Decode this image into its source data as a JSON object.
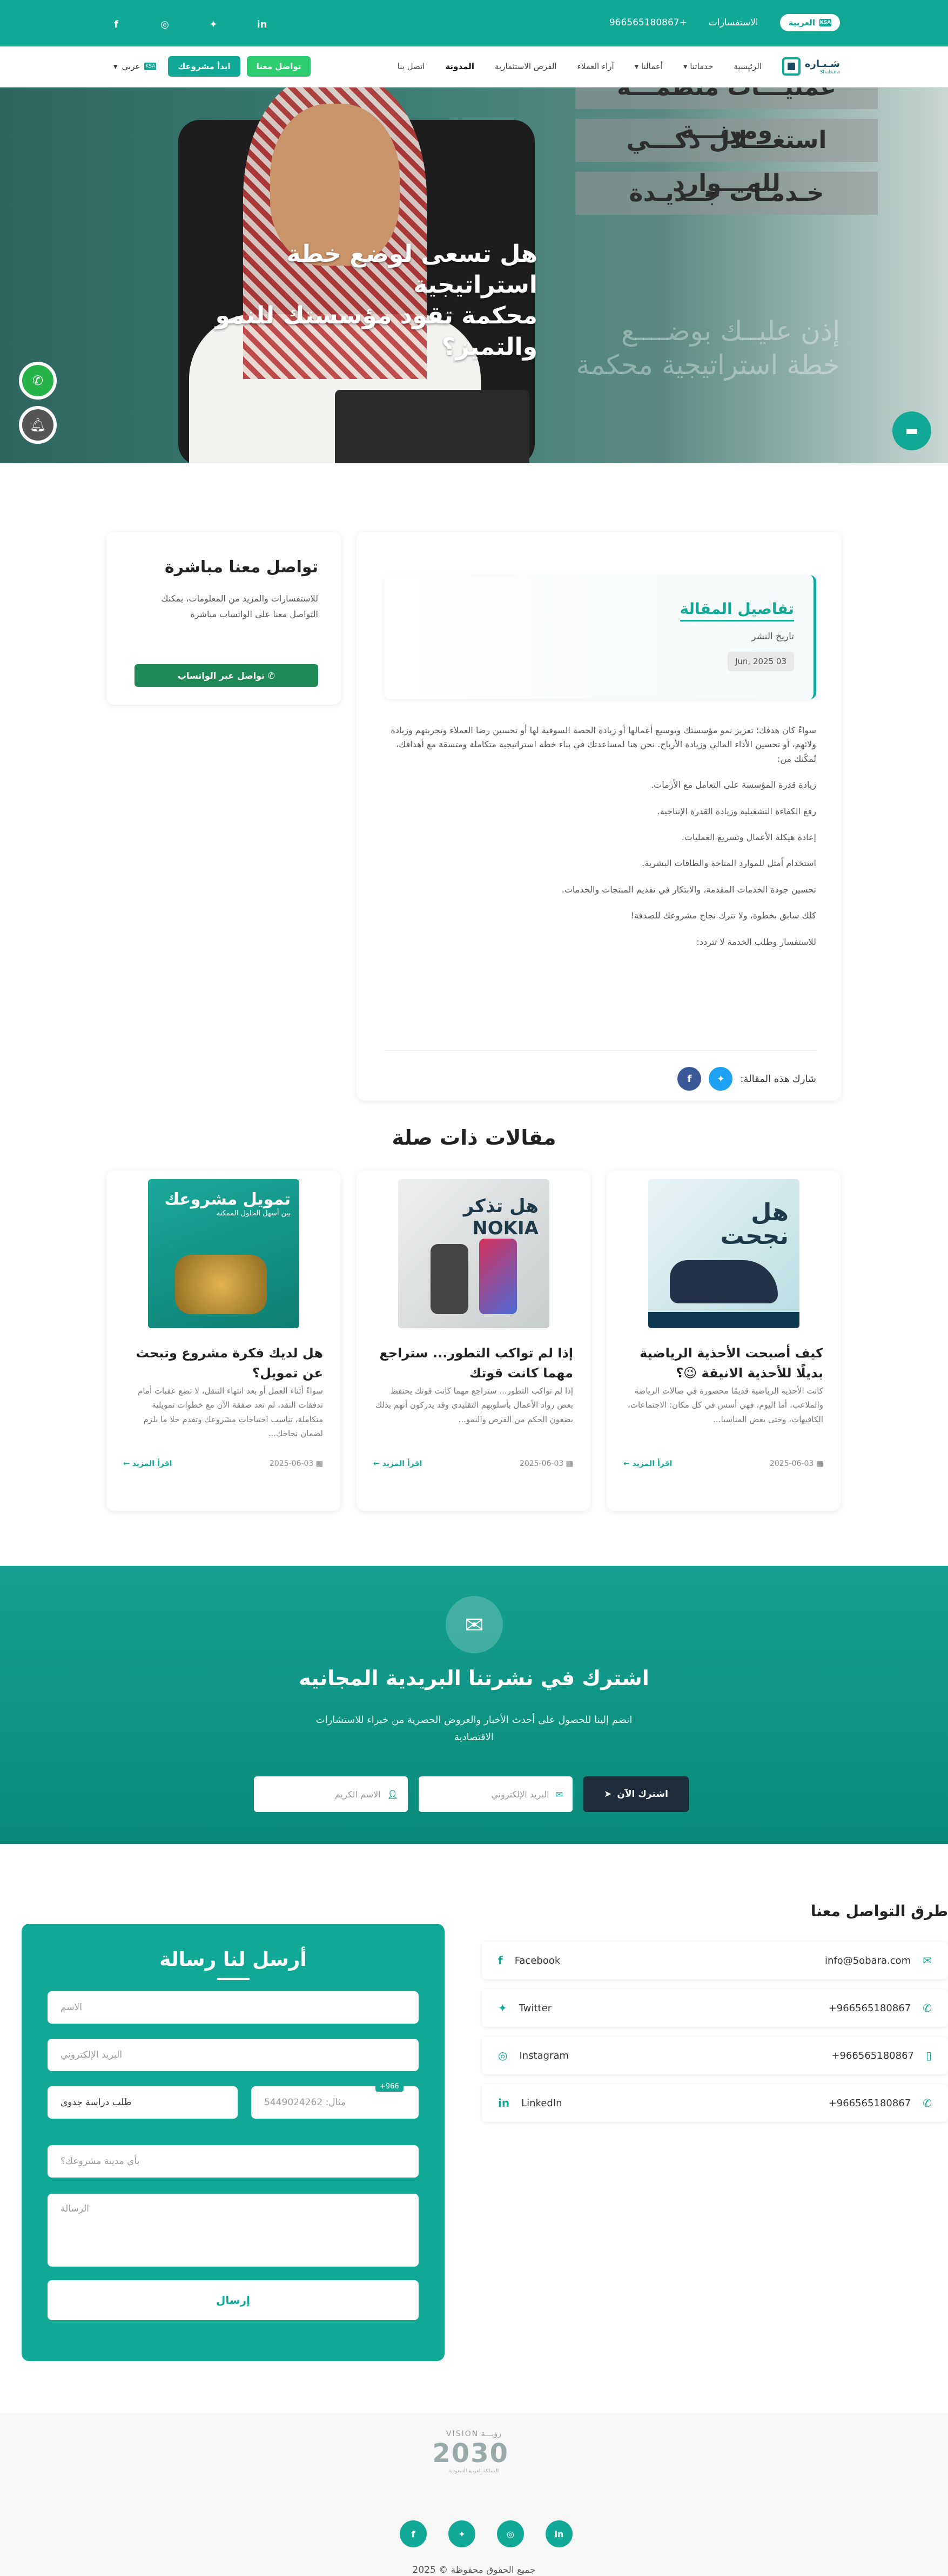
{
  "topbar": {
    "lang_label": "العربية",
    "flag": "KSA",
    "consult_label": "الاستفسارات",
    "phone": "966565180867+",
    "social_icons": [
      "in",
      "t",
      "ig",
      "f"
    ]
  },
  "nav": {
    "logo": "شـبـاره",
    "logo_sub": "Shabara",
    "links": [
      "الرئيسية",
      "خدماتنا",
      "أعمالنا",
      "آراء العملاء",
      "الفرص الاستثمارية",
      "المدونة",
      "اتصل بنا"
    ],
    "lang_select": "عربي",
    "start_project": "ابدأ مشروعك",
    "contact_us": "تواصل معنا"
  },
  "hero": {
    "bars": [
      "عمليـــات منظمـــة ومرنـــة",
      "استغـــلال ذكـــي للمـــوارد",
      "خـدمـات جــديـدة"
    ],
    "title_line1": "هل تسعى لوضع خطة استراتيجية",
    "title_line2": "محكمة تقود مؤسستك للنمو والتميز؟",
    "sub_line1": "إذن عليــك بوضــــع",
    "sub_line2": "خطة استراتيجية محكمة"
  },
  "article": {
    "details_title": "تفاصيل المقالة",
    "date_label": "تاريخ النشر",
    "date": "Jun, 2025 03",
    "intro": "سواءً كان هدفك؛ تعزيز نمو مؤسستك وتوسيع أعمالها أو زيادة الحصة السوقية لها أو تحسين رضا العملاء وتجربتهم وزيادة ولائهم، أو تحسين الأداء المالي وزيادة الأرباح. نحن هنا لمساعدتك في بناء خطة استراتيجية متكاملة ومتسقة مع أهدافك، تُمكّنك من:",
    "points": [
      "زيادة قدرة المؤسسة على التعامل مع الأزمات.",
      "رفع الكفاءة التشغيلية وزيادة القدرة الإنتاجية.",
      "إعادة هيكلة الأعمال وتسريع العمليات.",
      "استخدام أمثل للموارد المتاحة والطاقات البشرية.",
      "تحسين جودة الخدمات المقدمة، والابتكار في تقديم المنتجات والخدمات.",
      "كلك سابق بخطوة، ولا تترك نجاح مشروعك للصدفة!",
      "للاستفسار وطلب الخدمة لا تتردد:"
    ],
    "share_label": "شارك هذه المقالة:"
  },
  "contact_box": {
    "title": "تواصل معنا مباشرة",
    "text": "للاستفسارات والمزيد من المعلومات، يمكنك التواصل معنا على الواتساب مباشرة",
    "button": "تواصل عبر الواتساب"
  },
  "related": {
    "title": "مقالات ذات صلة",
    "items": [
      {
        "title": "كيف أصبحت الأحذية الرياضية بديلًا للأحذية الانيقة 😉؟",
        "excerpt": "كانت الأحذية الرياضية قديمًا محصورة في صالات الرياضة والملاعب، أما اليوم، فهي أسس في كل مكان: الاجتماعات، الكافيهات، وحتى بعض المناسبا...",
        "date": "2025-06-03",
        "more": "اقرأ المزيد",
        "img_text1": "هل",
        "img_text2": "نجحت"
      },
      {
        "title": "إذا لم تواكب التطور... ستراجع مهما كانت قوتك",
        "excerpt": "إذا لم تواكب التطور... ستراجع مهما كانت قوتك يحتفظ بعض رواد الأعمال بأسلوبهم التقليدي وقد يدركون أنهم بذلك يضعون الحكم من الفرص والنمو...",
        "date": "2025-06-03",
        "more": "اقرأ المزيد",
        "img_text1": "هل تذكر",
        "img_text2": "NOKIA"
      },
      {
        "title": "هل لديك فكرة مشروع وتبحث عن تمويل؟",
        "excerpt": "سواءً أثناء العمل أو بعد انتهاء التنقل، لا تضع عقبات أمام تدفقات النقد، لم تعد صفقة الآن مع خطوات تمويلية متكاملة، تناسب احتياجات مشروعك وتقدم حلا ما يلزم لضمان نجاحك...",
        "date": "2025-06-03",
        "more": "اقرأ المزيد",
        "img_text1": "تمويل مشروعك",
        "img_text2": "بين أسهل الحلول الممكنة"
      }
    ]
  },
  "newsletter": {
    "title": "اشترك في نشرتنا البريدية المجانيه",
    "subtitle": "انضم إلينا للحصول على أحدث الأخبار والعروض الحصرية من خبراء للاستشارات الاقتصادية",
    "name_placeholder": "الاسم الكريم",
    "email_placeholder": "البريد الإلكتروني",
    "button": "اشترك الآن"
  },
  "contact_ways": {
    "title": "طرق التواصل معنا",
    "rows": [
      {
        "label": "Facebook",
        "value": "info@5obara.com"
      },
      {
        "label": "Twitter",
        "value": "966565180867+"
      },
      {
        "label": "Instagram",
        "value": "966565180867+"
      },
      {
        "label": "LinkedIn",
        "value": "966565180867+"
      }
    ]
  },
  "message_form": {
    "title": "أرسل لنا رسالة",
    "name": "الاسم",
    "email": "البريد الإلكتروني",
    "phone": "مثال: 5449024262",
    "country_code": "+966",
    "service": "طلب دراسة جدوى",
    "city": "بأي مدينة مشروعك؟",
    "message": "الرسالة",
    "send": "إرسال"
  },
  "footer": {
    "vision_top": "رؤيـــة VISION",
    "vision_year": "2030",
    "vision_sub": "المملكة العربية السعودية",
    "copyright": "جميع الحقوق محفوظة © 2025"
  }
}
